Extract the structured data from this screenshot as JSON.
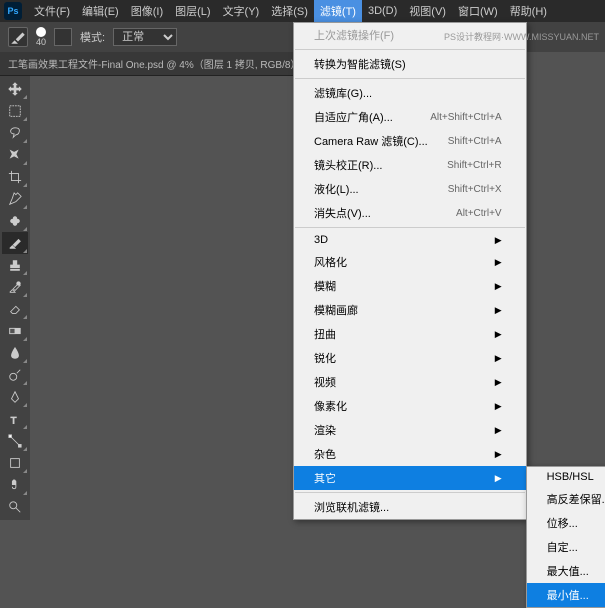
{
  "logo": "Ps",
  "menubar": [
    "文件(F)",
    "编辑(E)",
    "图像(I)",
    "图层(L)",
    "文字(Y)",
    "选择(S)",
    "滤镜(T)",
    "3D(D)",
    "视图(V)",
    "窗口(W)",
    "帮助(H)"
  ],
  "active_menu_index": 6,
  "options": {
    "size": "40",
    "mode_label": "模式:",
    "mode_value": "正常"
  },
  "doc_tab": "工笔画效果工程文件-Final One.psd @ 4%（图层 1 拷贝, RGB/8）",
  "watermark": "PS设计教程网·WWW.MISSYUAN.NET",
  "filter_menu": {
    "last": "上次滤镜操作(F)",
    "convert": "转换为智能滤镜(S)",
    "gallery": "滤镜库(G)...",
    "adaptive": "自适应广角(A)...",
    "adaptive_key": "Alt+Shift+Ctrl+A",
    "camera": "Camera Raw 滤镜(C)...",
    "camera_key": "Shift+Ctrl+A",
    "lens": "镜头校正(R)...",
    "lens_key": "Shift+Ctrl+R",
    "liquify": "液化(L)...",
    "liquify_key": "Shift+Ctrl+X",
    "vanish": "消失点(V)...",
    "vanish_key": "Alt+Ctrl+V",
    "cat_3d": "3D",
    "cat_stylize": "风格化",
    "cat_blur": "模糊",
    "cat_blur_gallery": "模糊画廊",
    "cat_distort": "扭曲",
    "cat_sharpen": "锐化",
    "cat_video": "视频",
    "cat_pixelate": "像素化",
    "cat_render": "渲染",
    "cat_noise": "杂色",
    "cat_other": "其它",
    "browse": "浏览联机滤镜..."
  },
  "other_submenu": {
    "hsb": "HSB/HSL",
    "highpass": "高反差保留...",
    "offset": "位移...",
    "custom": "自定...",
    "maximum": "最大值...",
    "minimum": "最小值..."
  }
}
